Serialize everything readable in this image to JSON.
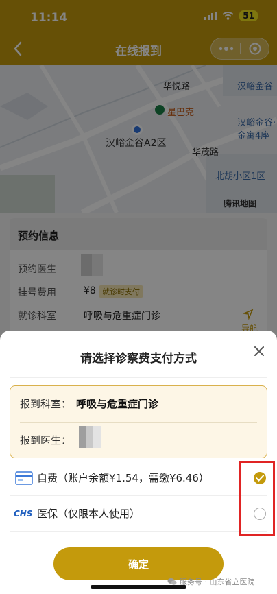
{
  "status": {
    "time": "11:14",
    "battery": "51"
  },
  "nav": {
    "title": "在线报到"
  },
  "map": {
    "labels": [
      "华悦路",
      "汉峪金谷",
      "星巴克",
      "汉峪金谷A2区",
      "汉峪金谷·金寓4座",
      "华茂路",
      "北胡小区1区",
      "腾讯地图"
    ]
  },
  "info": {
    "title": "预约信息",
    "doctor_label": "预约医生",
    "fee_label": "挂号费用",
    "fee_value": "¥8",
    "fee_badge": "就诊时支付",
    "dept_label": "就诊科室",
    "dept_value": "呼吸与危重症门诊",
    "nav_label": "导航"
  },
  "sheet": {
    "title": "请选择诊察费支付方式",
    "report_dept_label": "报到科室：",
    "report_dept_value": "呼吸与危重症门诊",
    "report_doctor_label": "报到医生：",
    "options": [
      {
        "label": "自费（账户余额¥1.54，需缴¥6.46）",
        "icon": "card-icon",
        "selected": true
      },
      {
        "label": "医保（仅限本人使用）",
        "icon": "chs-logo-icon",
        "selected": false
      }
    ],
    "confirm_label": "确定"
  },
  "watermark": "服务号 · 山东省立医院",
  "colors": {
    "accent": "#c49a0c",
    "highlight": "#e02424"
  }
}
